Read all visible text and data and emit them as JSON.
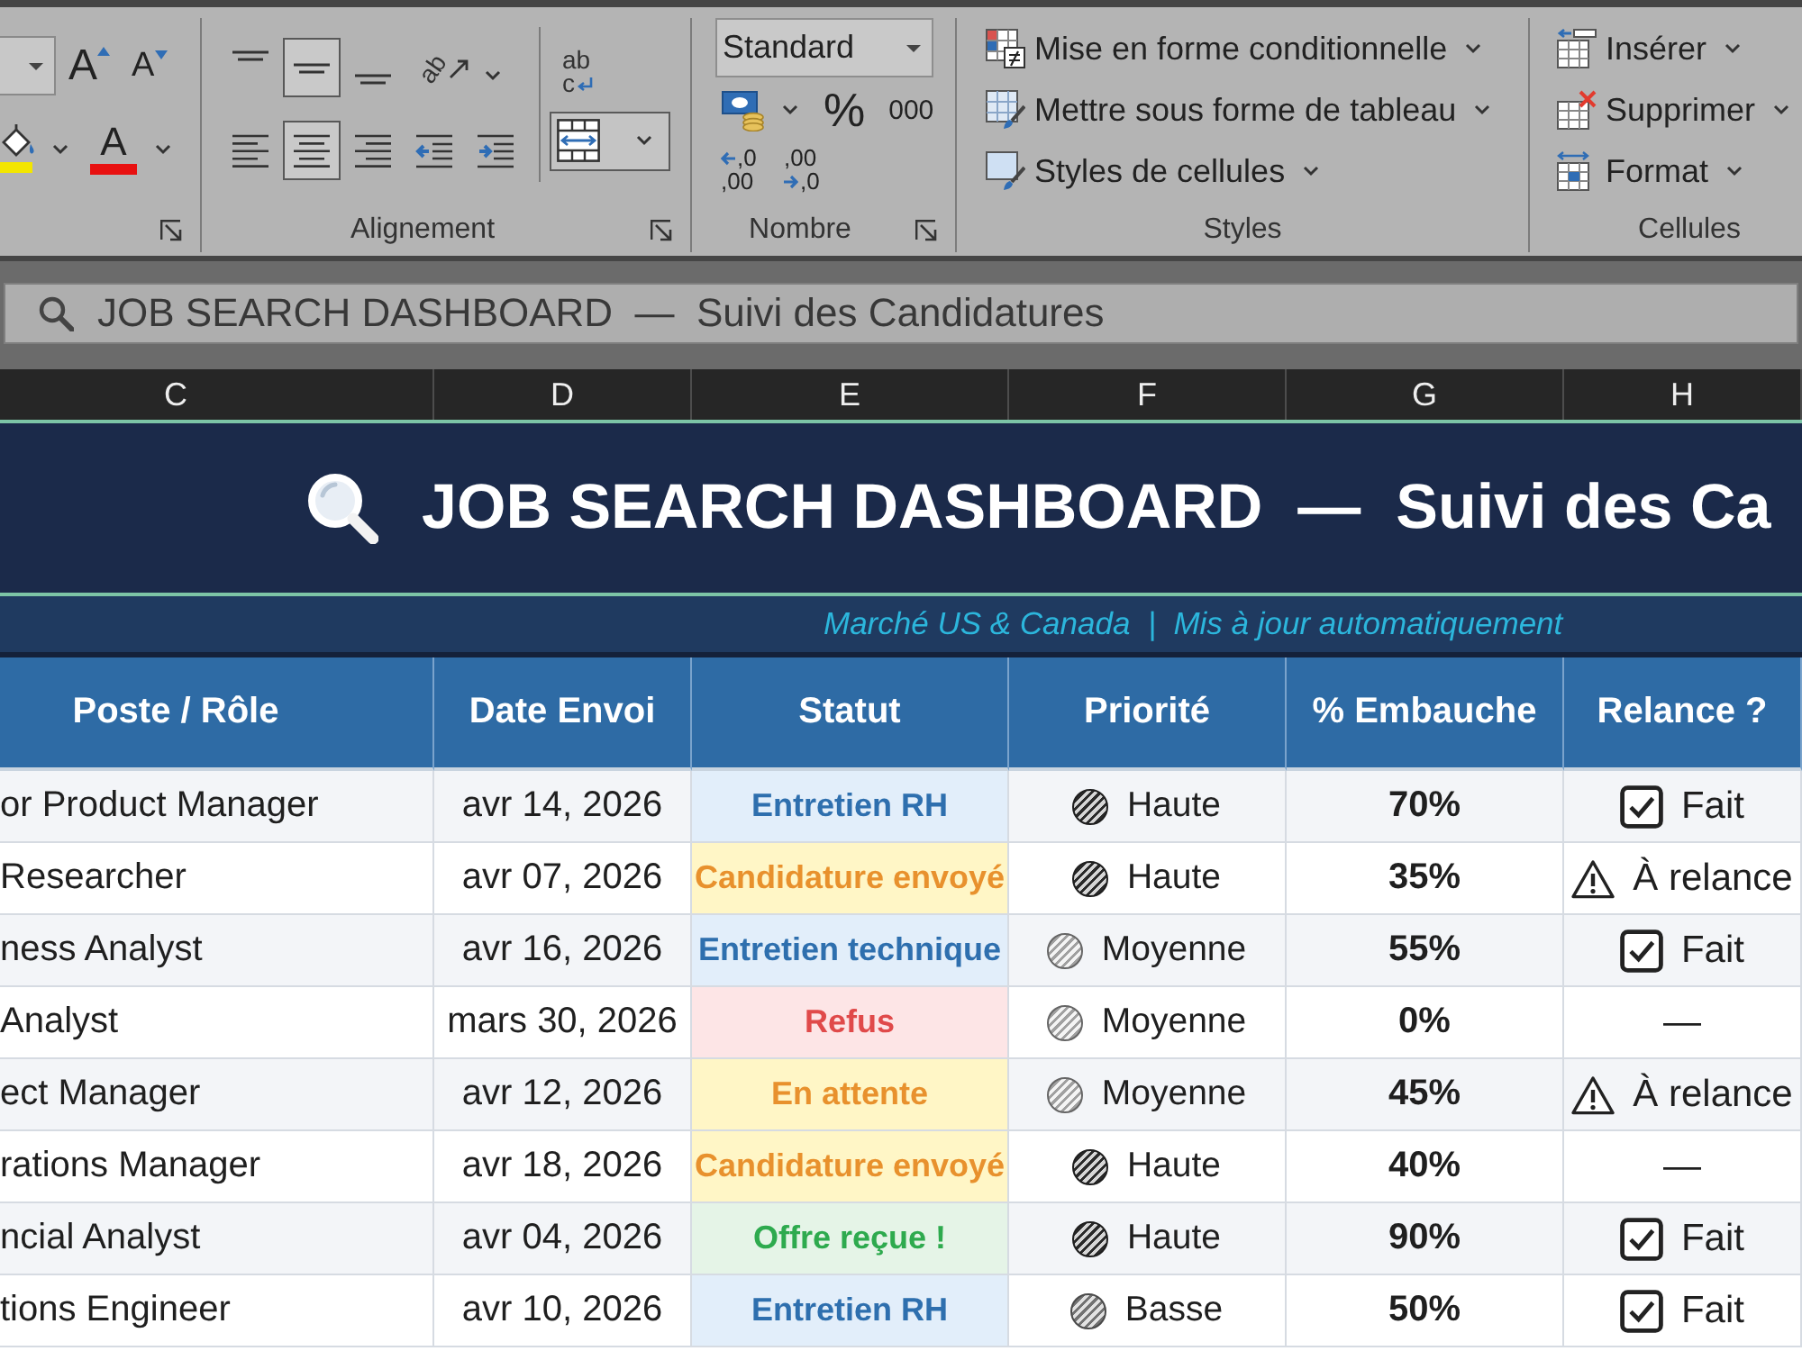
{
  "ribbon": {
    "font": {
      "grow_glyph": "A",
      "shrink_glyph": "A",
      "font_color_glyph": "A"
    },
    "alignment": {
      "title": "Alignement",
      "vertical": [
        {
          "kind": "top",
          "selected": false
        },
        {
          "kind": "middle",
          "selected": true
        },
        {
          "kind": "bottom",
          "selected": false
        }
      ],
      "orientation": "ab",
      "horizontal": [
        {
          "kind": "left",
          "selected": false
        },
        {
          "kind": "center",
          "selected": true
        },
        {
          "kind": "right",
          "selected": false
        }
      ],
      "wrap_text": [
        "ab",
        "c"
      ]
    },
    "number": {
      "title": "Nombre",
      "format": "Standard",
      "percent": "%",
      "thousands": "000",
      "decimals": [
        {
          "kind": "decrease",
          "lines": [
            ",0",
            ",00"
          ]
        },
        {
          "kind": "increase",
          "lines": [
            ",00",
            ",0"
          ]
        }
      ]
    },
    "styles": {
      "title": "Styles",
      "items": [
        {
          "kind": "conditional",
          "label": "Mise en forme conditionnelle"
        },
        {
          "kind": "table",
          "label": "Mettre sous forme de tableau"
        },
        {
          "kind": "cell_styles",
          "label": "Styles de cellules"
        }
      ]
    },
    "cells": {
      "title": "Cellules",
      "items": [
        {
          "kind": "insert",
          "label": "Insérer"
        },
        {
          "kind": "delete",
          "label": "Supprimer"
        },
        {
          "kind": "format",
          "label": "Format"
        }
      ]
    }
  },
  "name_bar": {
    "text": "JOB SEARCH DASHBOARD  —  Suivi des Candidatures"
  },
  "column_letters": [
    "C",
    "D",
    "E",
    "F",
    "G",
    "H"
  ],
  "banner": {
    "title": "JOB SEARCH DASHBOARD  —  Suivi des Ca",
    "subtitle": "Marché US & Canada  |  Mis à jour automatiquement"
  },
  "table": {
    "columns": [
      "Poste / Rôle",
      "Date Envoi",
      "Statut",
      "Priorité",
      "% Embauche",
      "Relance ?"
    ],
    "rows": [
      {
        "role": "or Product Manager",
        "date": "avr 14, 2026",
        "status": {
          "kind": "interview",
          "label": "Entretien RH",
          "color": "#2e6fae"
        },
        "priority": {
          "kind": "high",
          "label": "Haute"
        },
        "hire_rate": "70%",
        "follow_up": {
          "kind": "done",
          "label": "Fait"
        }
      },
      {
        "role": "Researcher",
        "date": "avr 07, 2026",
        "status": {
          "kind": "sent",
          "label": "Candidature envoyé",
          "color": "#e8912d"
        },
        "priority": {
          "kind": "high",
          "label": "Haute"
        },
        "hire_rate": "35%",
        "follow_up": {
          "kind": "todo",
          "label": "À relance"
        }
      },
      {
        "role": "ness Analyst",
        "date": "avr 16, 2026",
        "status": {
          "kind": "interview",
          "label": "Entretien technique",
          "color": "#2e6fae"
        },
        "priority": {
          "kind": "medium",
          "label": "Moyenne"
        },
        "hire_rate": "55%",
        "follow_up": {
          "kind": "done",
          "label": "Fait"
        }
      },
      {
        "role": "Analyst",
        "date": "mars 30, 2026",
        "status": {
          "kind": "rejected",
          "label": "Refus",
          "color": "#e04a4a"
        },
        "priority": {
          "kind": "medium",
          "label": "Moyenne"
        },
        "hire_rate": "0%",
        "follow_up": {
          "kind": "none",
          "label": "—"
        }
      },
      {
        "role": "ect Manager",
        "date": "avr 12, 2026",
        "status": {
          "kind": "waiting",
          "label": "En attente",
          "color": "#e8912d"
        },
        "priority": {
          "kind": "medium",
          "label": "Moyenne"
        },
        "hire_rate": "45%",
        "follow_up": {
          "kind": "todo",
          "label": "À relance"
        }
      },
      {
        "role": "rations Manager",
        "date": "avr 18, 2026",
        "status": {
          "kind": "sent",
          "label": "Candidature envoyé",
          "color": "#e8912d"
        },
        "priority": {
          "kind": "high",
          "label": "Haute"
        },
        "hire_rate": "40%",
        "follow_up": {
          "kind": "none",
          "label": "—"
        }
      },
      {
        "role": "ncial Analyst",
        "date": "avr 04, 2026",
        "status": {
          "kind": "offer",
          "label": "Offre reçue !",
          "color": "#2eaa4e"
        },
        "priority": {
          "kind": "high",
          "label": "Haute"
        },
        "hire_rate": "90%",
        "follow_up": {
          "kind": "done",
          "label": "Fait"
        }
      },
      {
        "role": "tions Engineer",
        "date": "avr 10, 2026",
        "status": {
          "kind": "interview",
          "label": "Entretien RH",
          "color": "#2e6fae"
        },
        "priority": {
          "kind": "low",
          "label": "Basse"
        },
        "hire_rate": "50%",
        "follow_up": {
          "kind": "done",
          "label": "Fait"
        }
      }
    ]
  }
}
